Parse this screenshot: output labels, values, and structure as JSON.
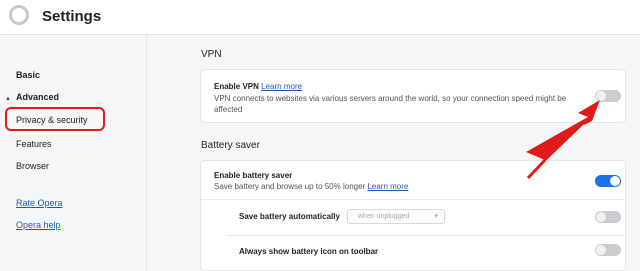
{
  "header": {
    "title": "Settings",
    "logo_icon": "opera-logo-icon"
  },
  "sidebar": {
    "items": [
      {
        "label": "Basic"
      },
      {
        "label": "Advanced"
      },
      {
        "label": "Privacy & security"
      },
      {
        "label": "Features"
      },
      {
        "label": "Browser"
      }
    ],
    "links": [
      {
        "label": "Rate Opera"
      },
      {
        "label": "Opera help"
      }
    ]
  },
  "vpn": {
    "section_title": "VPN",
    "title": "Enable VPN",
    "learn_more": "Learn more",
    "desc_line1": "VPN connects to websites via various servers around the world, so your connection speed might be",
    "desc_line2": "affected",
    "enabled": false
  },
  "battery": {
    "section_title": "Battery saver",
    "title": "Enable battery saver",
    "desc": "Save battery and browse up to 50% longer",
    "learn_more": "Learn more",
    "enabled": true,
    "auto_label": "Save battery automatically",
    "auto_select_value": "when unplugged",
    "auto_enabled": false,
    "icon_label": "Always show battery icon on toolbar",
    "icon_enabled": false
  },
  "colors": {
    "accent": "#1a73e8",
    "annotation": "#e01b1b"
  }
}
